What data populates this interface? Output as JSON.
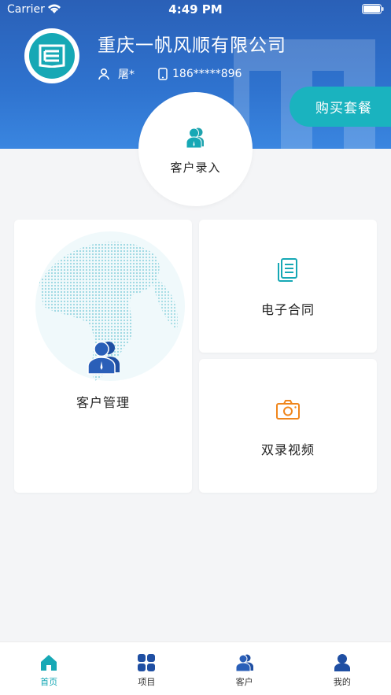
{
  "status_bar": {
    "carrier": "Carrier",
    "time": "4:49 PM"
  },
  "header": {
    "company_name": "重庆一帆风顺有限公司",
    "user_name": "屠*",
    "phone": "186*****896",
    "buy_button": "购买套餐"
  },
  "entry": {
    "label": "客户录入"
  },
  "cards": {
    "management": "客户管理",
    "contract": "电子合同",
    "video": "双录视频"
  },
  "tabs": [
    {
      "label": "首页",
      "icon": "home-icon"
    },
    {
      "label": "项目",
      "icon": "grid-icon"
    },
    {
      "label": "客户",
      "icon": "customer-icon"
    },
    {
      "label": "我的",
      "icon": "profile-icon"
    }
  ],
  "colors": {
    "header_blue": "#2f73cf",
    "teal": "#16a8b5",
    "navy": "#1f4fa3",
    "orange": "#f0861c"
  }
}
